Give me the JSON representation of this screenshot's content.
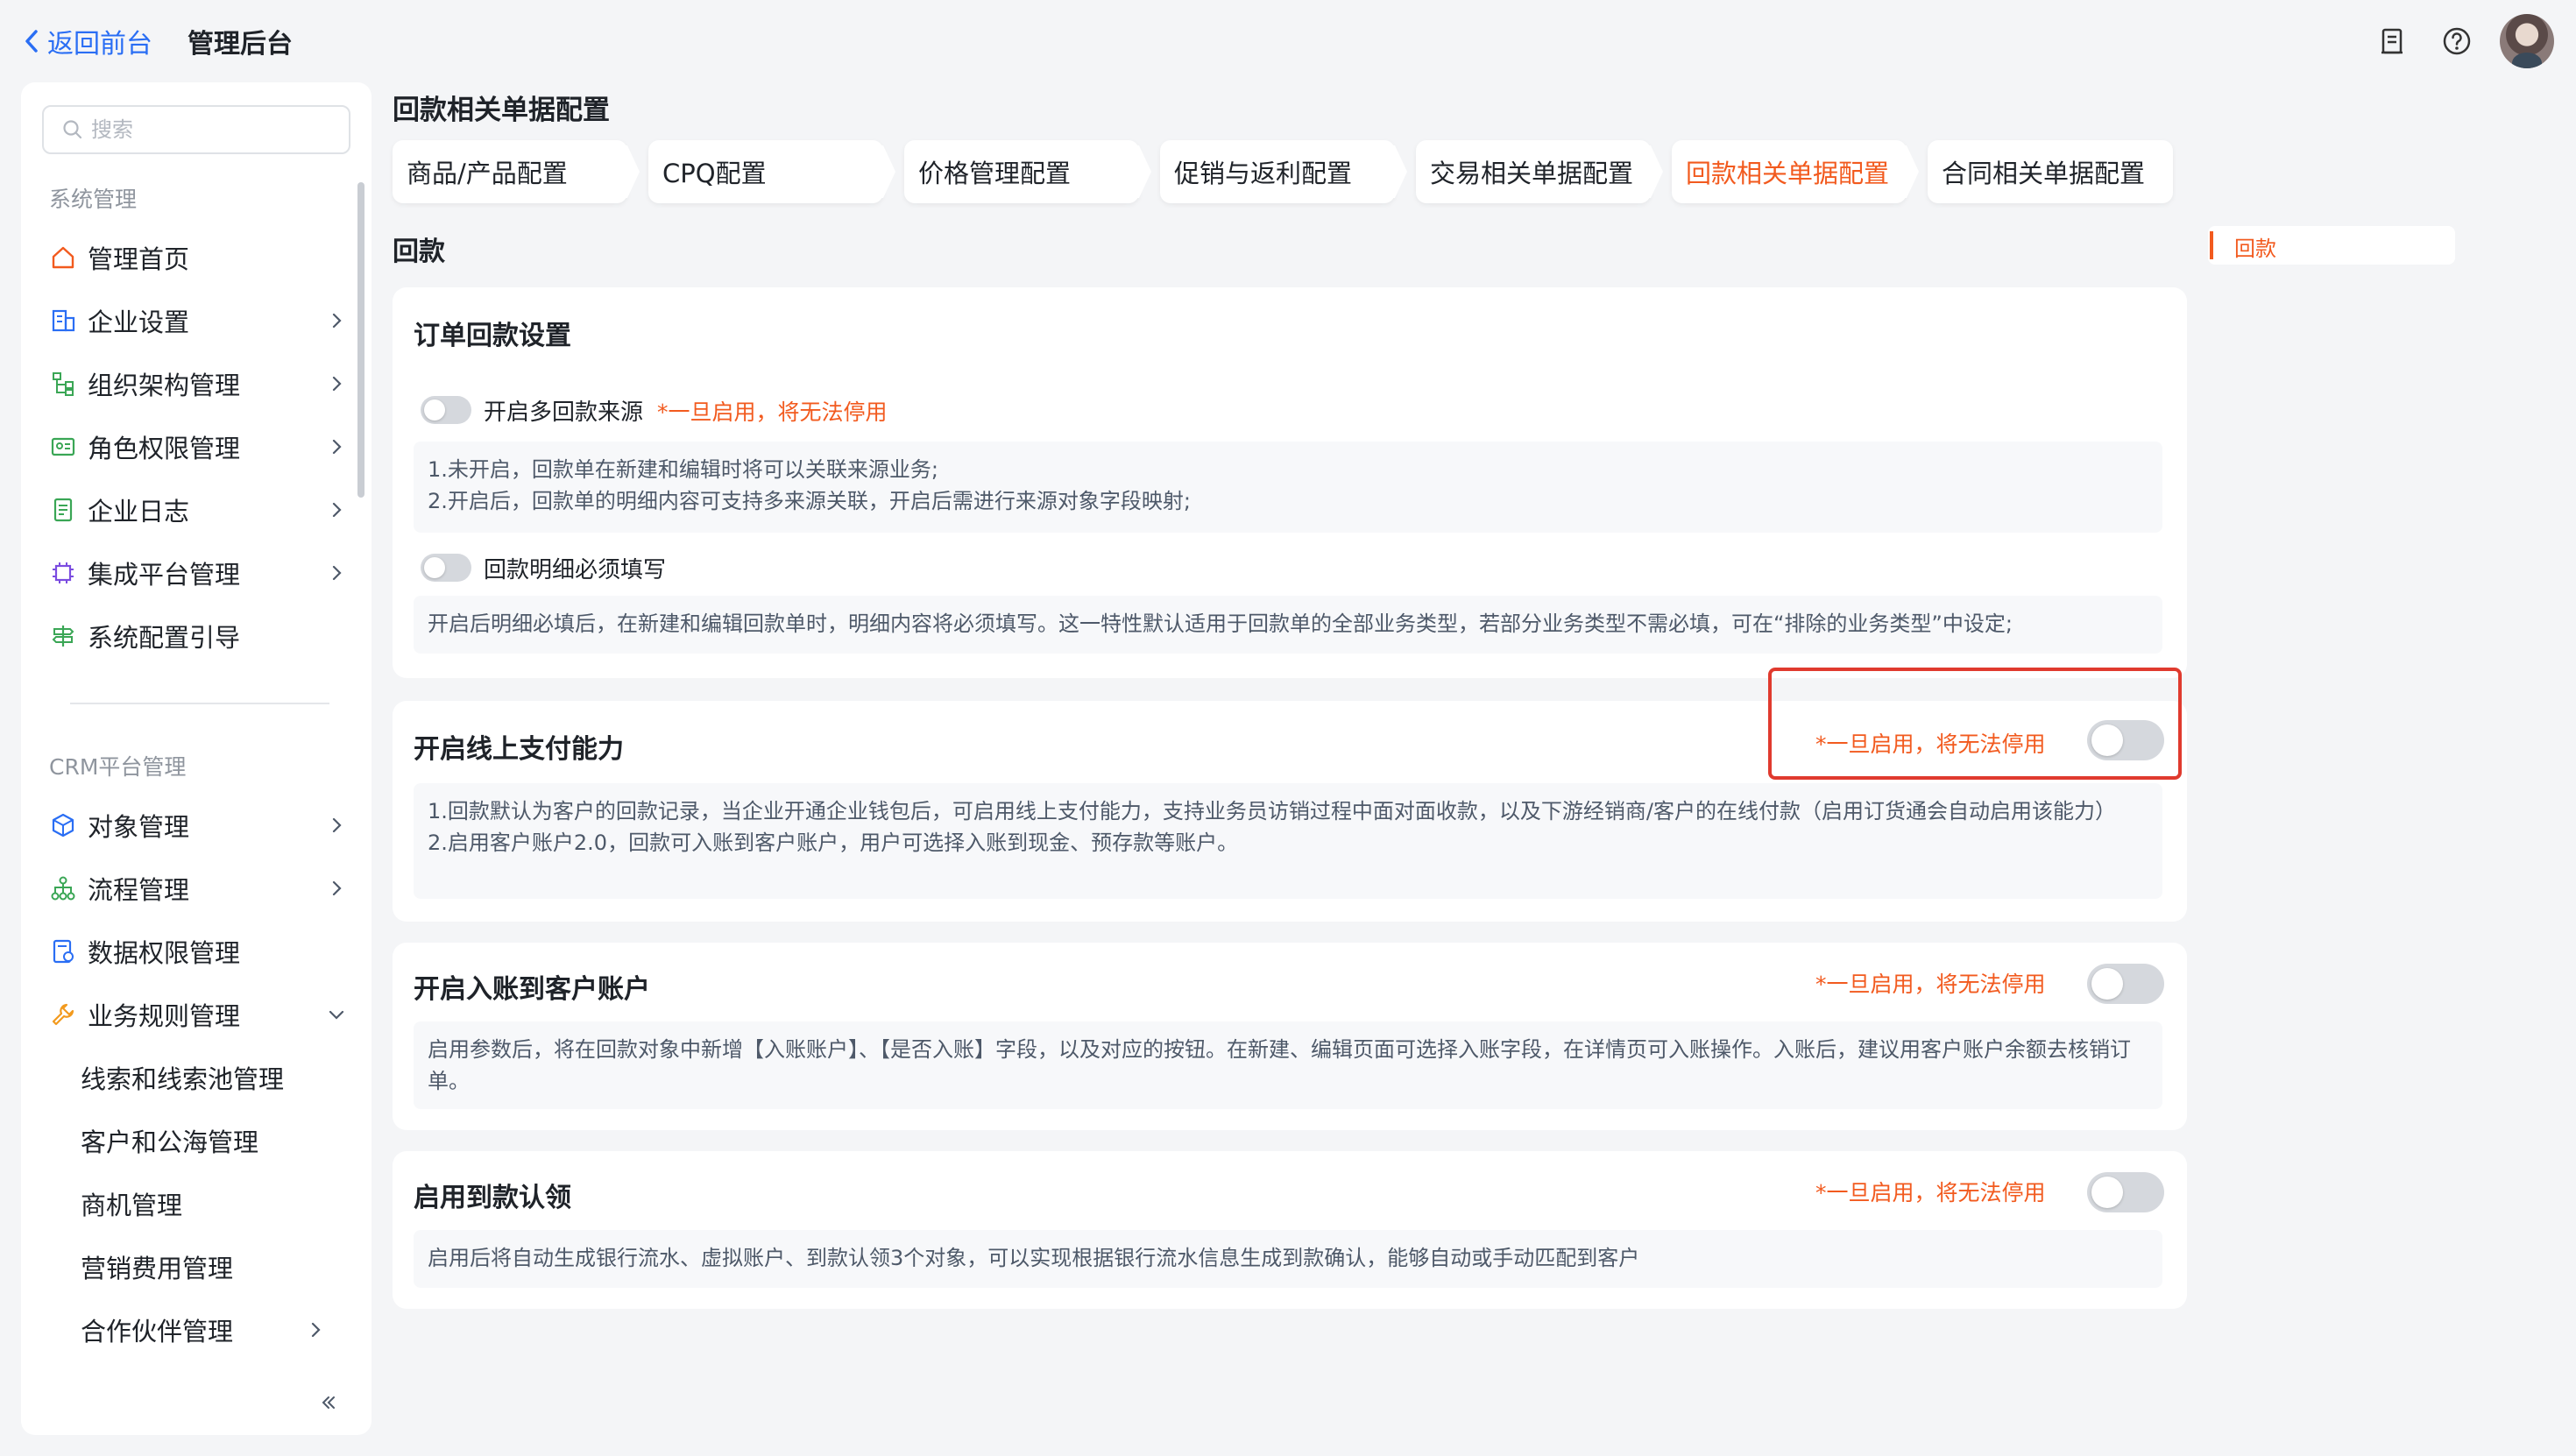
{
  "header": {
    "back_label": "返回前台",
    "title": "管理后台",
    "icons": [
      "document-icon",
      "help-icon",
      "avatar"
    ]
  },
  "sidebar": {
    "search_placeholder": "搜索",
    "section1": "系统管理",
    "items1": [
      {
        "label": "管理首页",
        "icon": "home-icon"
      },
      {
        "label": "企业设置",
        "icon": "building-icon"
      },
      {
        "label": "组织架构管理",
        "icon": "org-icon"
      },
      {
        "label": "角色权限管理",
        "icon": "id-card-icon"
      },
      {
        "label": "企业日志",
        "icon": "log-icon"
      },
      {
        "label": "集成平台管理",
        "icon": "chip-icon"
      },
      {
        "label": "系统配置引导",
        "icon": "signpost-icon"
      }
    ],
    "section2": "CRM平台管理",
    "items2": [
      {
        "label": "对象管理",
        "icon": "cube-icon"
      },
      {
        "label": "流程管理",
        "icon": "flow-icon"
      },
      {
        "label": "数据权限管理",
        "icon": "data-lock-icon"
      },
      {
        "label": "业务规则管理",
        "icon": "wrench-icon"
      }
    ],
    "sub_items": [
      "线索和线索池管理",
      "客户和公海管理",
      "商机管理",
      "营销费用管理",
      "合作伙伴管理"
    ]
  },
  "main": {
    "page_title": "回款相关单据配置",
    "tabs": [
      "商品/产品配置",
      "CPQ配置",
      "价格管理配置",
      "促销与返利配置",
      "交易相关单据配置",
      "回款相关单据配置",
      "合同相关单据配置"
    ],
    "active_tab": 5,
    "section_label": "回款",
    "anchor_label": "回款",
    "warning": "*一旦启用，将无法停用",
    "card1": {
      "title": "订单回款设置",
      "opt1_label": "开启多回款来源",
      "opt1_desc": [
        "1.未开启，回款单在新建和编辑时将可以关联来源业务;",
        "2.开启后，回款单的明细内容可支持多来源关联，开启后需进行来源对象字段映射;"
      ],
      "opt2_label": "回款明细必须填写",
      "opt2_desc": "开启后明细必填后，在新建和编辑回款单时，明细内容将必须填写。这一特性默认适用于回款单的全部业务类型，若部分业务类型不需必填，可在“排除的业务类型”中设定;"
    },
    "card2": {
      "title": "开启线上支付能力",
      "desc": [
        "1.回款默认为客户的回款记录，当企业开通企业钱包后，可启用线上支付能力，支持业务员访销过程中面对面收款，以及下游经销商/客户的在线付款（启用订货通会自动启用该能力）",
        "2.启用客户账户2.0，回款可入账到客户账户，用户可选择入账到现金、预存款等账户。"
      ]
    },
    "card3": {
      "title": "开启入账到客户账户",
      "desc": "启用参数后，将在回款对象中新增【入账账户】、【是否入账】字段，以及对应的按钮。在新建、编辑页面可选择入账字段，在详情页可入账操作。入账后，建议用客户账户余额去核销订单。"
    },
    "card4": {
      "title": "启用到款认领",
      "desc": "启用后将自动生成银行流水、虚拟账户、到款认领3个对象，可以实现根据银行流水信息生成到款确认，能够自动或手动匹配到客户"
    }
  },
  "colors": {
    "accent": "#f25a1e",
    "link": "#2a6ef4",
    "highlight": "#e03a2e"
  }
}
